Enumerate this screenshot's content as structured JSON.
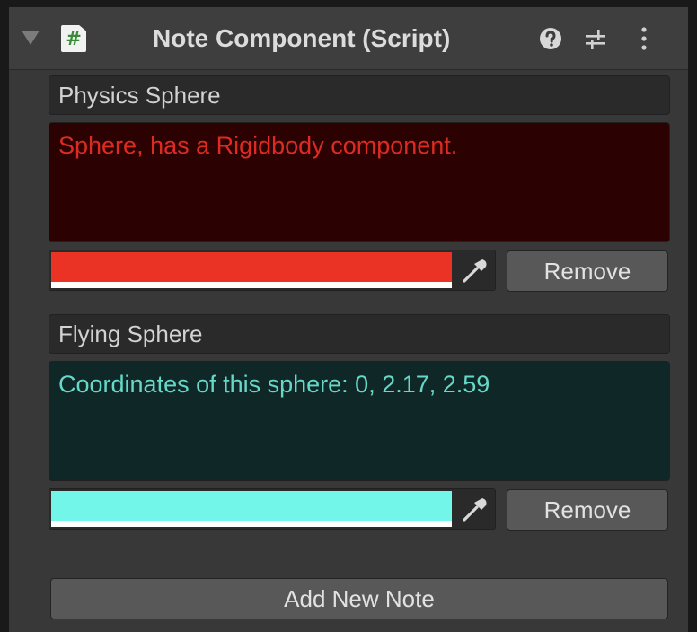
{
  "header": {
    "title": "Note Component (Script)",
    "script_icon_glyph": "#",
    "icons": [
      "foldout-arrow-icon",
      "script-file-icon",
      "help-icon",
      "presets-sliders-icon",
      "kebab-menu-icon"
    ]
  },
  "notes": [
    {
      "name": "Physics Sphere",
      "text": "Sphere, has a Rigidbody component.",
      "color": "#ea3324",
      "text_color": "#dc2b23",
      "background": "#2b0101",
      "remove_label": "Remove"
    },
    {
      "name": "Flying Sphere",
      "text": "Coordinates of this sphere: 0, 2.17, 2.59",
      "color": "#72f6ea",
      "text_color": "#66d8c8",
      "background": "#0f2726",
      "remove_label": "Remove"
    }
  ],
  "footer": {
    "add_label": "Add New Note"
  },
  "colors": {
    "panel_bg": "#383838",
    "header_bg": "#3e3e3e",
    "field_bg": "#2a2a2a",
    "button_bg": "#585858"
  }
}
